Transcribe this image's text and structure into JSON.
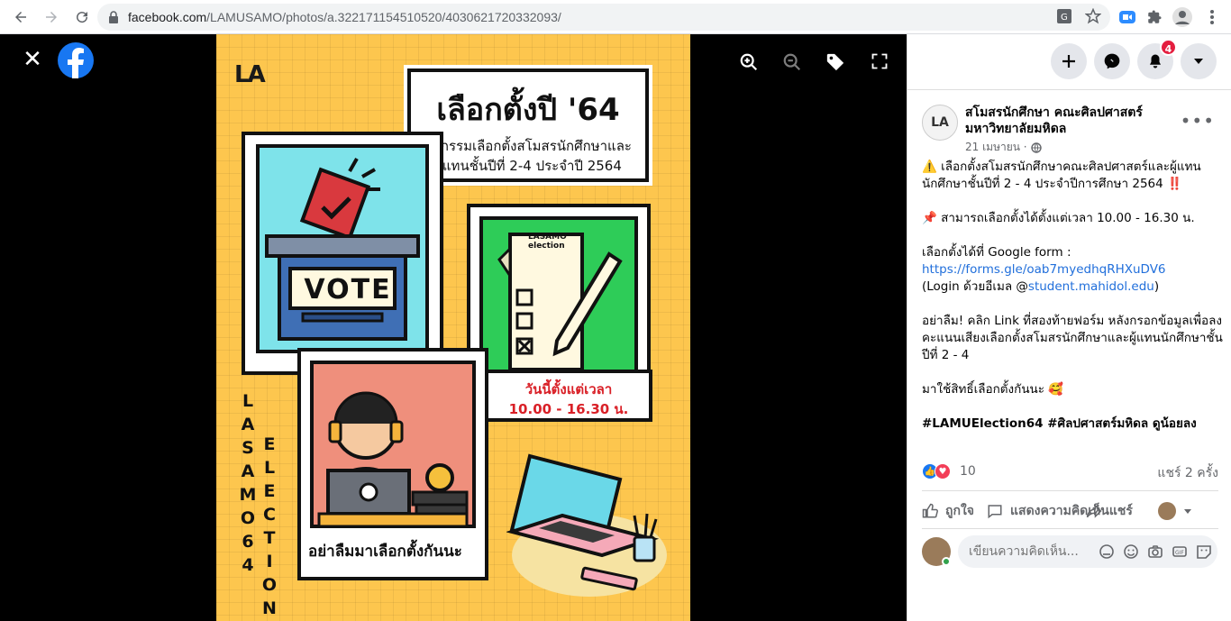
{
  "browser": {
    "url_host": "facebook.com",
    "url_path": "/LAMUSAMO/photos/a.322171154510520/4030621720332093/",
    "icons": [
      "back-icon",
      "forward-icon",
      "reload-icon",
      "lock-icon",
      "translate-icon",
      "star-icon",
      "zoom-extension-icon",
      "extensions-icon",
      "profile-icon",
      "menu-icon"
    ]
  },
  "poster": {
    "logo": "LA",
    "title": "เลือกตั้งปี '64",
    "subtitle_line1": "กิจกรรมเลือกตั้งสโมสรนักศึกษาและ",
    "subtitle_line2": "ผู้แทนชั้นปีที่ 2-4 ประจำปี 2564",
    "vote_sign": "VOTE",
    "ballot_label": "LASAMO election",
    "time_line1": "วันนี้ตั้งแต่เวลา",
    "time_line2": "10.00 - 16.30 น.",
    "reminder": "อย่าลืมมาเลือกตั้งกันนะ",
    "vertical_left": "LASAMO64",
    "vertical_right": "ELECTION"
  },
  "header": {
    "notification_count": "4"
  },
  "post": {
    "page_name": "สโมสรนักศึกษา คณะศิลปศาสตร์ มหาวิทยาลัยมหิดล",
    "date": "21 เมษายน ·",
    "paragraph1": "⚠️ เลือกตั้งสโมสรนักศึกษาคณะศิลปศาสตร์และผู้แทนนักศึกษาชั้นปีที่ 2 - 4 ประจำปีการศึกษา 2564 ‼️",
    "paragraph2": "📌 สามารถเลือกตั้งได้ตั้งแต่เวลา 10.00 - 16.30 น.",
    "form_label": "เลือกตั้งได้ที่ Google form :",
    "form_link": "https://forms.gle/oab7myedhqRHXuDV6",
    "login_prefix": "(Login ด้วยอีเมล @",
    "login_link": "student.mahidol.edu",
    "login_suffix": ")",
    "paragraph4": "อย่าลืม! คลิก Link ที่สองท้ายฟอร์ม หลังกรอกข้อมูลเพื่อลงคะแนนเสียงเลือกตั้งสโมสรนักศึกษาและผู้แทนนักศึกษาชั้นปีที่ 2 - 4",
    "paragraph5": "มาใช้สิทธิ์เลือกตั้งกันนะ 🥰",
    "hashtags": "#LAMUElection64 #ศิลปศาสตร์มหิดล ดูน้อยลง",
    "reaction_count": "10",
    "shares": "แชร์ 2 ครั้ง",
    "like_label": "ถูกใจ",
    "comment_label": "แสดงความคิดเห็น",
    "share_label": "แชร์"
  },
  "comment": {
    "placeholder": "เขียนความคิดเห็น..."
  },
  "colors": {
    "fb_blue": "#1877f2",
    "poster_yellow": "#fdc64e",
    "link": "#216fdb",
    "badge_red": "#e41e3f"
  }
}
